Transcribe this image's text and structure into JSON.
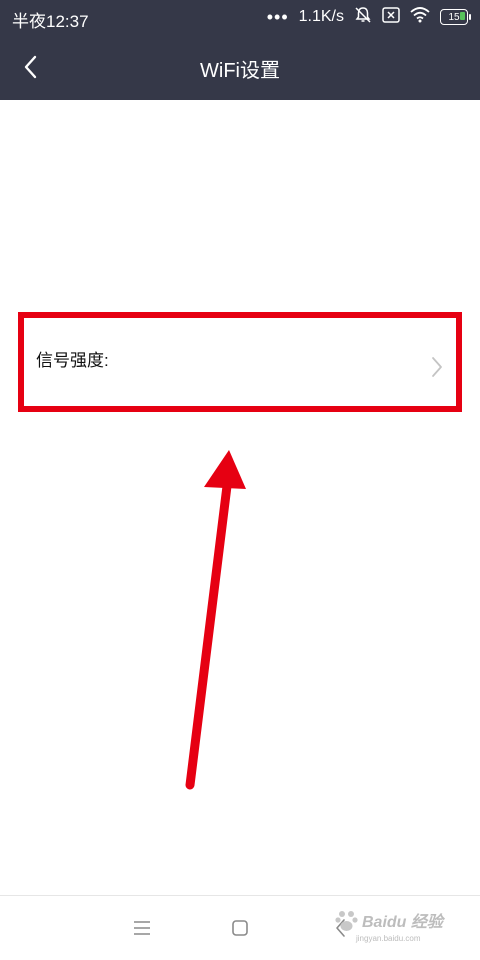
{
  "status_bar": {
    "time": "半夜12:37",
    "more": "•••",
    "network_speed": "1.1K/s",
    "battery_level": "15",
    "icons": [
      "mute-bell-icon",
      "sim-x-icon",
      "wifi-icon",
      "battery-icon"
    ],
    "battery_fill_color": "#56c25b"
  },
  "app_bar": {
    "title": "WiFi设置",
    "background": "#353848"
  },
  "settings": {
    "signal_strength_label": "信号强度:"
  },
  "annotation": {
    "color": "#e60012"
  },
  "nav_bar": {
    "icons": [
      "menu-icon",
      "home-icon",
      "back-icon"
    ]
  },
  "watermark": {
    "main": "Baidu 经验",
    "sub": "jingyan.baidu.com"
  }
}
